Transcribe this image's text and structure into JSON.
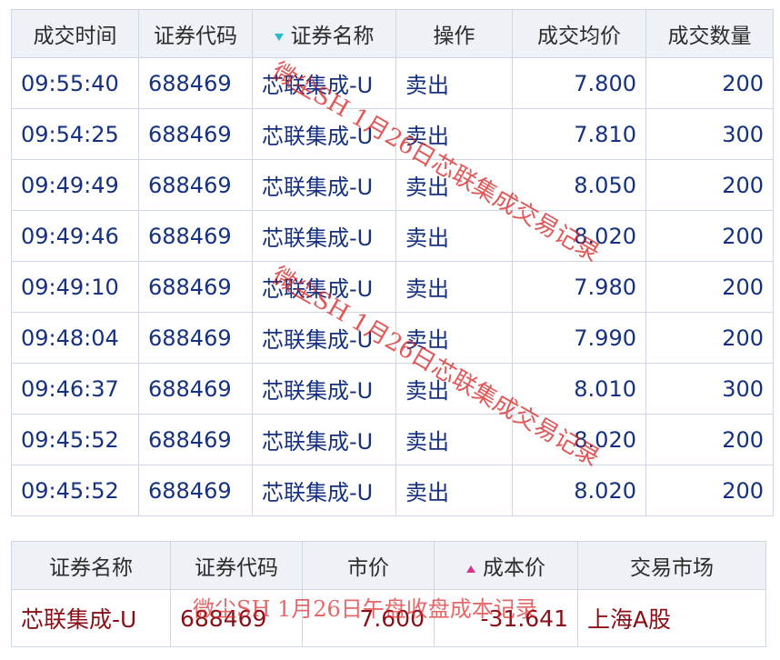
{
  "trades": {
    "headers": [
      "成交时间",
      "证券代码",
      "证券名称",
      "操作",
      "成交均价",
      "成交数量"
    ],
    "rows": [
      {
        "time": "09:55:40",
        "code": "688469",
        "name": "芯联集成-U",
        "op": "卖出",
        "price": "7.800",
        "qty": "200"
      },
      {
        "time": "09:54:25",
        "code": "688469",
        "name": "芯联集成-U",
        "op": "卖出",
        "price": "7.810",
        "qty": "300"
      },
      {
        "time": "09:49:49",
        "code": "688469",
        "name": "芯联集成-U",
        "op": "卖出",
        "price": "8.050",
        "qty": "200"
      },
      {
        "time": "09:49:46",
        "code": "688469",
        "name": "芯联集成-U",
        "op": "卖出",
        "price": "8.020",
        "qty": "200"
      },
      {
        "time": "09:49:10",
        "code": "688469",
        "name": "芯联集成-U",
        "op": "卖出",
        "price": "7.980",
        "qty": "200"
      },
      {
        "time": "09:48:04",
        "code": "688469",
        "name": "芯联集成-U",
        "op": "卖出",
        "price": "7.990",
        "qty": "200"
      },
      {
        "time": "09:46:37",
        "code": "688469",
        "name": "芯联集成-U",
        "op": "卖出",
        "price": "8.010",
        "qty": "300"
      },
      {
        "time": "09:45:52",
        "code": "688469",
        "name": "芯联集成-U",
        "op": "卖出",
        "price": "8.020",
        "qty": "200"
      },
      {
        "time": "09:45:52",
        "code": "688469",
        "name": "芯联集成-U",
        "op": "卖出",
        "price": "8.020",
        "qty": "200"
      }
    ]
  },
  "holdings": {
    "headers": [
      "证券名称",
      "证券代码",
      "市价",
      "成本价",
      "交易市场"
    ],
    "row": {
      "name": "芯联集成-U",
      "code": "688469",
      "price": "7.600",
      "cost": "-31.641",
      "market": "上海A股"
    }
  },
  "watermarks": {
    "trades_text": "微尘SH 1月26日芯联集成交易记录",
    "holdings_text": "微尘SH 1月26日午盘收盘成本记录"
  },
  "colors": {
    "header_bg": "#eef1f6",
    "grid_line": "#cfd6e2",
    "trade_text": "#15317f",
    "holding_text": "#8a1018",
    "watermark": "#da2828",
    "sort_desc_indicator": "#28b8cf",
    "sort_asc_indicator": "#d4338e"
  },
  "icons": {
    "trades_sort": "sort-descending-triangle-icon",
    "holdings_sort": "sort-ascending-triangle-icon"
  }
}
